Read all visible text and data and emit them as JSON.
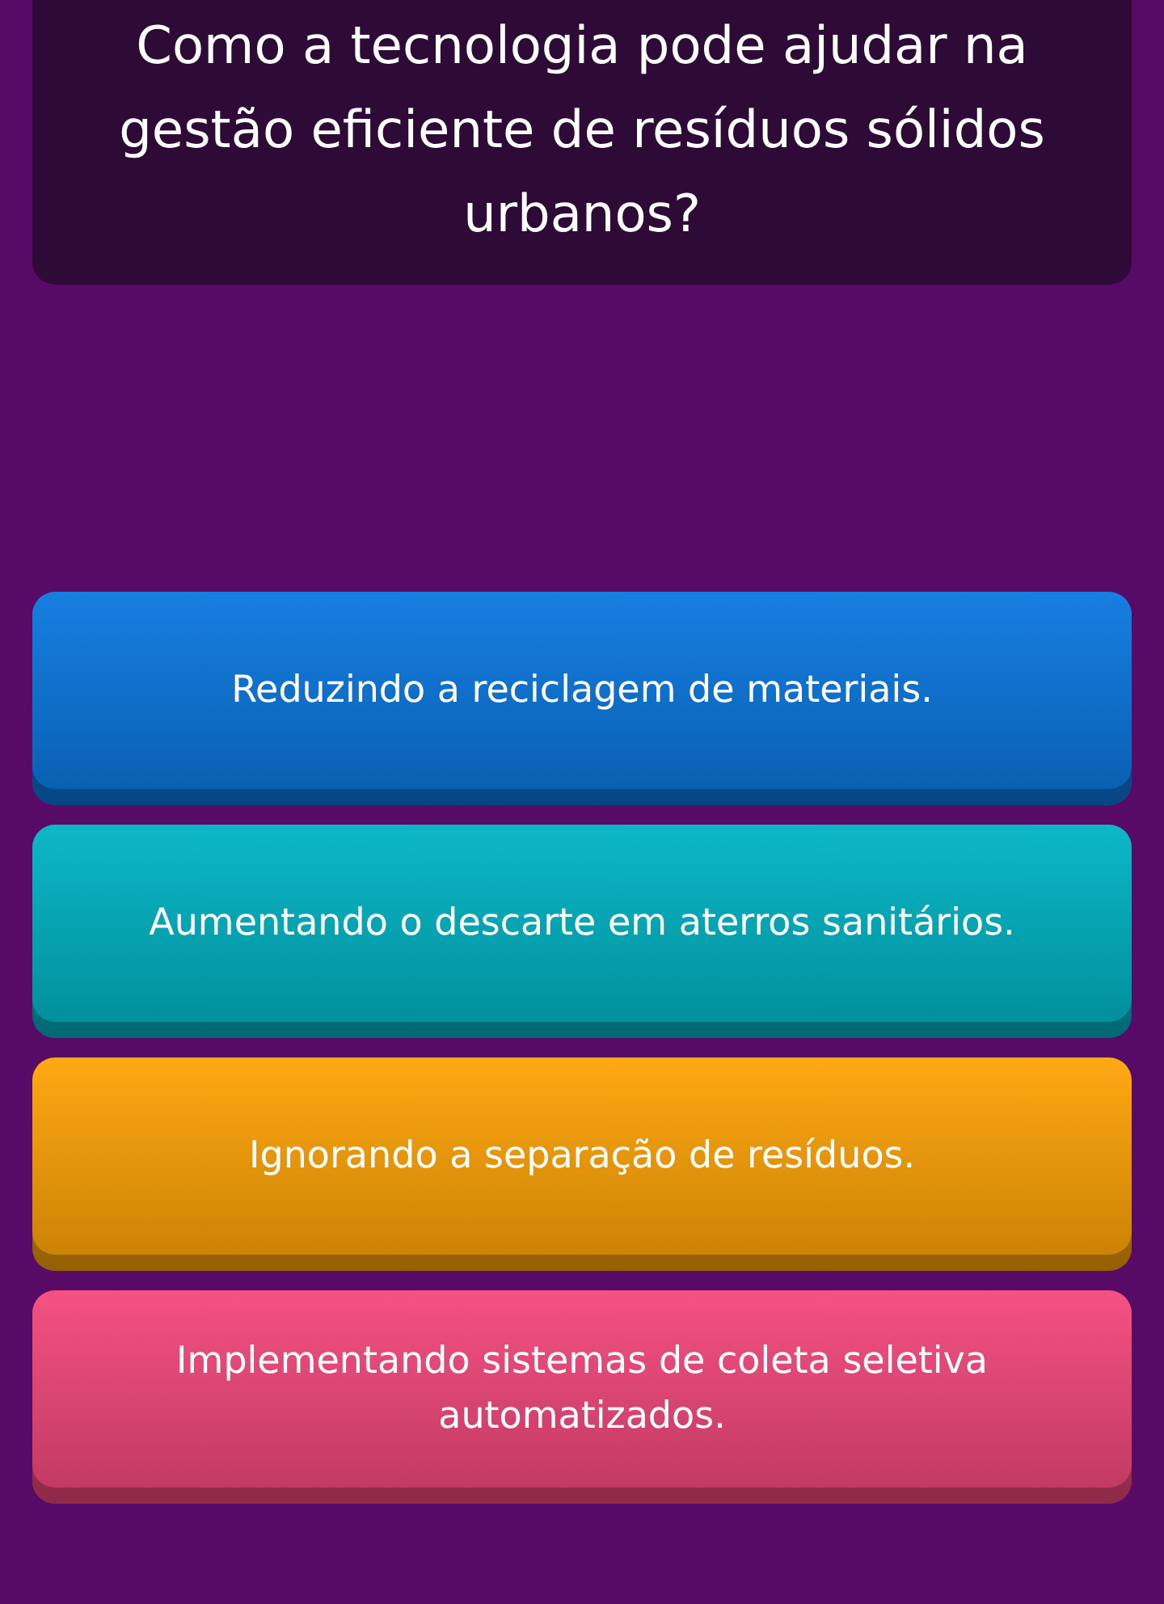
{
  "question": "Como a tecnologia pode ajudar na gestão eficiente de resíduos sólidos urbanos?",
  "options": [
    {
      "text": "Reduzindo a reciclagem de materiais.",
      "color": "#0a78e0"
    },
    {
      "text": "Aumentando o descarte em aterros sanitários.",
      "color": "#00b4c4"
    },
    {
      "text": "Ignorando a separação de resíduos.",
      "color": "#ffa406"
    },
    {
      "text": "Implementando sistemas de coleta seletiva automatizados.",
      "color": "#f4487c"
    }
  ]
}
